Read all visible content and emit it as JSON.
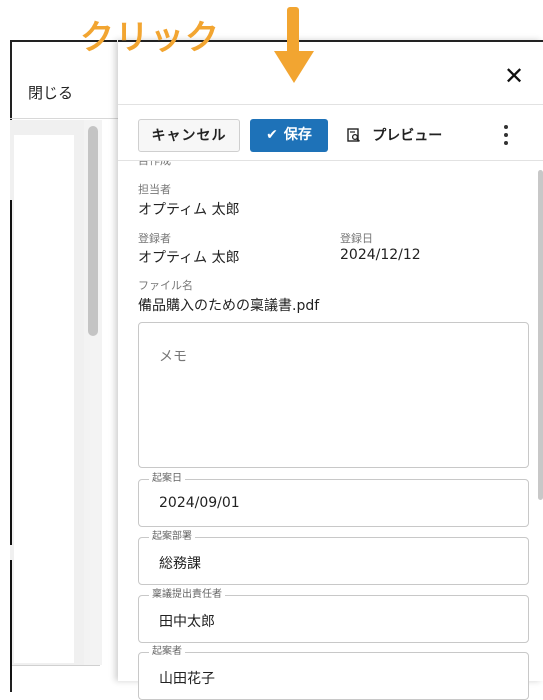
{
  "annotation": {
    "text": "クリック",
    "arrow": "down-arrow",
    "color": "#f2a531"
  },
  "background_window": {
    "close_label": "閉じる"
  },
  "panel": {
    "close_icon": "close-icon",
    "toolbar": {
      "cancel_label": "キャンセル",
      "save_label": "保存",
      "save_icon": "check-icon",
      "preview_label": "プレビュー",
      "preview_icon": "preview-icon",
      "more_icon": "more-vert-icon"
    },
    "fields": {
      "cut_label": "目作成",
      "tantousha_label": "担当者",
      "tantousha_value": "オプティム 太郎",
      "touroku_label": "登録者",
      "touroku_value": "オプティム 太郎",
      "tourokubi_label": "登録日",
      "tourokubi_value": "2024/12/12",
      "filename_label": "ファイル名",
      "filename_value": "備品購入のための稟議書.pdf",
      "memo_placeholder": "メモ"
    },
    "form": [
      {
        "label": "起案日",
        "value": "2024/09/01"
      },
      {
        "label": "起案部署",
        "value": "総務課"
      },
      {
        "label": "稟議提出責任者",
        "value": "田中太郎"
      },
      {
        "label": "起案者",
        "value": "山田花子"
      }
    ],
    "accent_color": "#1e72b8"
  }
}
